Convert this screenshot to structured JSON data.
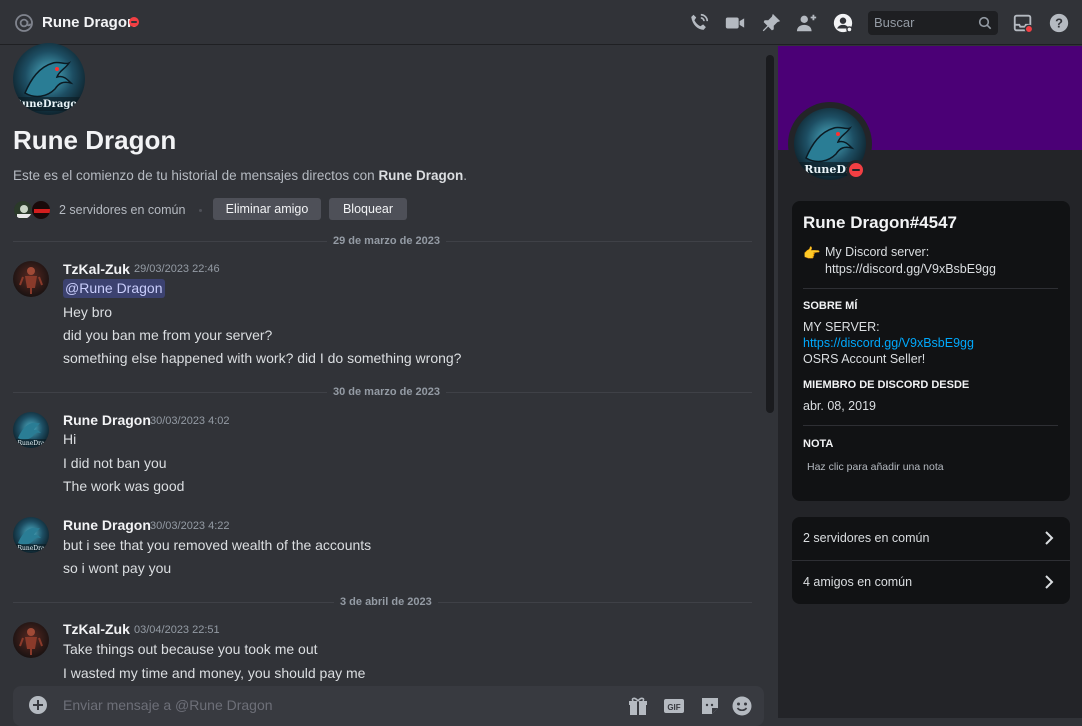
{
  "header": {
    "title": "Rune Dragon",
    "search_placeholder": "Buscar",
    "icons": [
      "at-icon",
      "voice-call-icon",
      "video-call-icon",
      "pin-icon",
      "add-friend-icon",
      "user-profile-icon",
      "search-icon",
      "inbox-icon",
      "help-icon"
    ]
  },
  "intro": {
    "name": "Rune Dragon",
    "desc_prefix": "Este es el comienzo de tu historial de mensajes directos con ",
    "desc_name": "Rune Dragon",
    "desc_suffix": ".",
    "mutual_servers": "2 servidores en común",
    "remove_friend": "Eliminar amigo",
    "block": "Bloquear"
  },
  "dates": [
    "29 de marzo de 2023",
    "30 de marzo de 2023",
    "3 de abril de 2023"
  ],
  "messages": [
    {
      "author": "TzKal-Zuk",
      "time": "29/03/2023 22:46",
      "mention": "@Rune Dragon",
      "lines": [
        "Hey bro",
        "did you ban me from your server?",
        "something else happened with work? did I do something wrong?"
      ]
    },
    {
      "author": "Rune Dragon",
      "time": "30/03/2023 4:02",
      "lines": [
        "Hi",
        "I did not ban you",
        "The work was good"
      ]
    },
    {
      "author": "Rune Dragon",
      "time": "30/03/2023 4:22",
      "lines": [
        "but i see that you removed wealth of the accounts",
        "so i wont pay you"
      ]
    },
    {
      "author": "TzKal-Zuk",
      "time": "03/04/2023 22:51",
      "lines": [
        "Take things out because you took me out",
        "I wasted my time and money, you should pay me"
      ]
    }
  ],
  "composer": {
    "placeholder": "Enviar mensaje a @Rune Dragon"
  },
  "profile": {
    "username": "Rune Dragon#4547",
    "custom_status_emoji": "👉",
    "custom_status_line1": "My Discord server:",
    "custom_status_line2": "https://discord.gg/V9xBsbE9gg",
    "about_heading": "SOBRE MÍ",
    "about_line1": "MY SERVER:",
    "about_link": "https://discord.gg/V9xBsbE9gg",
    "about_line3": "OSRS Account Seller!",
    "member_since_heading": "MIEMBRO DE DISCORD DESDE",
    "member_since": "abr. 08, 2019",
    "note_heading": "NOTA",
    "note_placeholder": "Haz clic para añadir una nota",
    "mutual_servers": "2 servidores en común",
    "mutual_friends": "4 amigos en común",
    "banner_color": "#4b0076"
  },
  "colors": {
    "dnd": "#f23f43",
    "link": "#00a8fc",
    "mention_bg": "#3c4270"
  }
}
